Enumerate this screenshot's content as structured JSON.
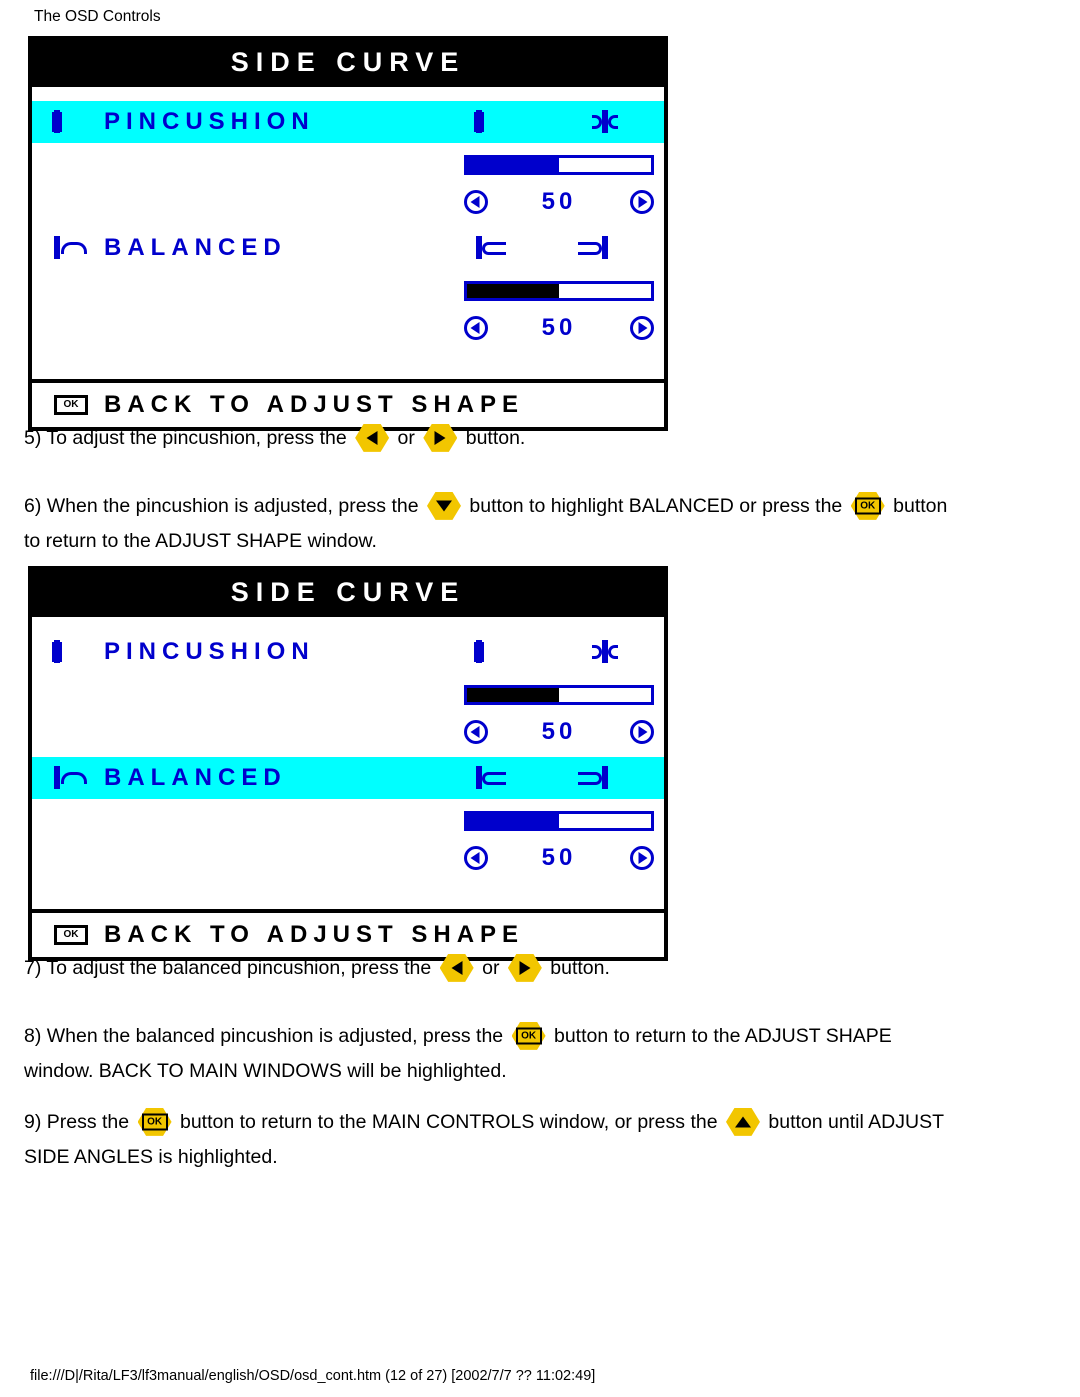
{
  "header": {
    "title": "The OSD Controls"
  },
  "osd_panels": [
    {
      "title": "SIDE CURVE",
      "rows": [
        {
          "label": "PINCUSHION",
          "highlighted": true,
          "value": "50",
          "fill_percent": 50,
          "left_icon": "pincushion-icon",
          "mid_icon": "pincushion-less-icon",
          "right_icon": "pincushion-more-icon"
        },
        {
          "label": "BALANCED",
          "highlighted": false,
          "value": "50",
          "fill_percent": 50,
          "left_icon": "balanced-icon",
          "mid_icon": "balanced-left-icon",
          "right_icon": "balanced-right-icon"
        }
      ],
      "footer": {
        "ok_label": "OK",
        "label": "BACK TO ADJUST SHAPE"
      }
    },
    {
      "title": "SIDE CURVE",
      "rows": [
        {
          "label": "PINCUSHION",
          "highlighted": false,
          "value": "50",
          "fill_percent": 50,
          "left_icon": "pincushion-icon",
          "mid_icon": "pincushion-less-icon",
          "right_icon": "pincushion-more-icon"
        },
        {
          "label": "BALANCED",
          "highlighted": true,
          "value": "50",
          "fill_percent": 50,
          "left_icon": "balanced-icon",
          "mid_icon": "balanced-left-icon",
          "right_icon": "balanced-right-icon"
        }
      ],
      "footer": {
        "ok_label": "OK",
        "label": "BACK TO ADJUST SHAPE"
      }
    }
  ],
  "steps": {
    "step5": {
      "a": "5) To adjust the pincushion, press the",
      "b": "or",
      "c": "button."
    },
    "step6": {
      "a": "6) When the pincushion is adjusted, press the",
      "b": "button to highlight BALANCED or press the",
      "c": "button",
      "d": "to return to the ADJUST SHAPE window."
    },
    "step7": {
      "a": "7) To adjust the balanced pincushion, press the",
      "b": "or",
      "c": "button."
    },
    "step8": {
      "a": "8) When the balanced pincushion is adjusted, press the",
      "b": "button to return to the ADJUST SHAPE",
      "c": "window. BACK TO MAIN WINDOWS will be highlighted."
    },
    "step9": {
      "a": "9) Press the",
      "b": "button to return to the MAIN CONTROLS window, or press the",
      "c": "button until ADJUST",
      "d": "SIDE ANGLES is highlighted."
    },
    "ok_glyph": "OK"
  },
  "footer": {
    "path": "file:///D|/Rita/LF3/lf3manual/english/OSD/osd_cont.htm (12 of 27) [2002/7/7 ?? 11:02:49]"
  }
}
